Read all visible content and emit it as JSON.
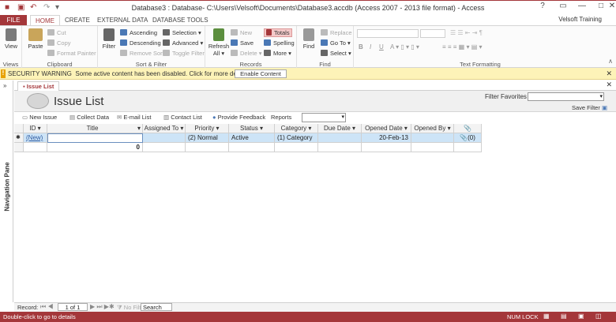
{
  "window": {
    "title": "Database3 : Database- C:\\Users\\Velsoft\\Documents\\Database3.accdb (Access 2007 - 2013 file format) - Access"
  },
  "ribbon_tabs": [
    "FILE",
    "HOME",
    "CREATE",
    "EXTERNAL DATA",
    "DATABASE TOOLS"
  ],
  "user": "Velsoft Training",
  "ribbon": {
    "views": {
      "view": "View",
      "label": "Views"
    },
    "clipboard": {
      "paste": "Paste",
      "cut": "Cut",
      "copy": "Copy",
      "format_painter": "Format Painter",
      "label": "Clipboard"
    },
    "sort_filter": {
      "filter": "Filter",
      "ascending": "Ascending",
      "descending": "Descending",
      "remove_sort": "Remove Sort",
      "selection": "Selection",
      "advanced": "Advanced",
      "toggle_filter": "Toggle Filter",
      "label": "Sort & Filter"
    },
    "records": {
      "refresh": "Refresh",
      "all": "All",
      "new": "New",
      "save": "Save",
      "delete": "Delete",
      "totals": "Totals",
      "spelling": "Spelling",
      "more": "More",
      "label": "Records"
    },
    "find": {
      "find": "Find",
      "replace": "Replace",
      "goto": "Go To",
      "select": "Select",
      "label": "Find"
    },
    "text_formatting": {
      "label": "Text Formatting"
    }
  },
  "security": {
    "heading": "SECURITY WARNING",
    "message": "Some active content has been disabled. Click for more details.",
    "button": "Enable Content"
  },
  "nav_pane": {
    "label": "Navigation Pane"
  },
  "doc_tab": {
    "label": "Issue List"
  },
  "form": {
    "title": "Issue List",
    "filter_favorites": "Filter Favorites",
    "save_filter": "Save Filter"
  },
  "toolbar": {
    "new_issue": "New Issue",
    "collect_data": "Collect Data",
    "email_list": "E-mail List",
    "contact_list": "Contact List",
    "provide_feedback": "Provide Feedback",
    "reports": "Reports"
  },
  "grid": {
    "columns": [
      "ID",
      "Title",
      "Assigned To",
      "Priority",
      "Status",
      "Category",
      "Due Date",
      "Opened Date",
      "Opened By",
      "📎"
    ],
    "row1": {
      "id": "(New)",
      "title": "",
      "assigned_to": "",
      "priority": "(2) Normal",
      "status": "Active",
      "category": "(1) Category",
      "due_date": "",
      "opened_date": "20-Feb-13",
      "opened_by": "",
      "attach": "📎(0)"
    },
    "total_row": {
      "title_total": "0"
    }
  },
  "record_nav": {
    "record_label": "Record:",
    "position": "1 of 1",
    "no_filter": "No Filter",
    "search": "Search"
  },
  "status_bar": {
    "left": "Double-click to go to details",
    "num_lock": "NUM LOCK"
  },
  "colors": {
    "accent": "#a4373a",
    "warning_bg": "#fdf3b8",
    "selected_row": "#cde4f7"
  }
}
